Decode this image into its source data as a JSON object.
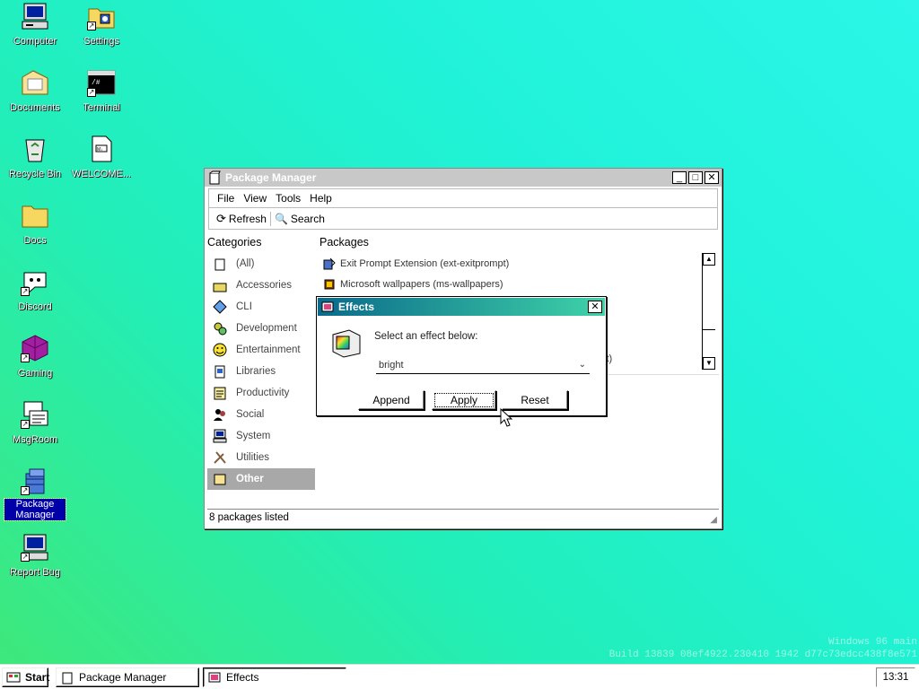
{
  "desktop": {
    "icons": [
      {
        "label": "Computer",
        "icon": "computer-icon"
      },
      {
        "label": "Settings",
        "icon": "settings-folder-icon"
      },
      {
        "label": "Documents",
        "icon": "documents-folder-icon"
      },
      {
        "label": "Terminal",
        "icon": "terminal-icon"
      },
      {
        "label": "Recycle Bin",
        "icon": "recycle-bin-icon"
      },
      {
        "label": "WELCOME...",
        "icon": "document-icon"
      },
      {
        "label": "Docs",
        "icon": "folder-icon"
      },
      {
        "label": "Discord",
        "icon": "discord-icon"
      },
      {
        "label": "Gaming",
        "icon": "gaming-icon"
      },
      {
        "label": "MsgRoom",
        "icon": "msgroom-icon"
      },
      {
        "label": "Package Manager",
        "icon": "package-manager-icon"
      },
      {
        "label": "Report Bug",
        "icon": "report-bug-icon"
      }
    ],
    "watermark": {
      "line1": "Windows 96 main",
      "line2": "Build 13839 08ef4922.230410 1942 d77c73edcc438f8e571"
    }
  },
  "package_manager": {
    "title": "Package Manager",
    "menu": [
      "File",
      "View",
      "Tools",
      "Help"
    ],
    "toolbar": {
      "refresh": "Refresh",
      "search": "Search"
    },
    "categories_header": "Categories",
    "packages_header": "Packages",
    "categories": [
      {
        "label": "(All)",
        "icon": "all-icon"
      },
      {
        "label": "Accessories",
        "icon": "accessories-icon"
      },
      {
        "label": "CLI",
        "icon": "cli-icon"
      },
      {
        "label": "Development",
        "icon": "development-icon"
      },
      {
        "label": "Entertainment",
        "icon": "entertainment-icon"
      },
      {
        "label": "Libraries",
        "icon": "libraries-icon"
      },
      {
        "label": "Productivity",
        "icon": "productivity-icon"
      },
      {
        "label": "Social",
        "icon": "social-icon"
      },
      {
        "label": "System",
        "icon": "system-icon"
      },
      {
        "label": "Utilities",
        "icon": "utilities-icon"
      },
      {
        "label": "Other",
        "icon": "other-icon",
        "selected": true
      }
    ],
    "packages": [
      "Exit Prompt Extension (ext-exitprompt)",
      "Microsoft wallpapers (ms-wallpapers)"
    ],
    "partial_package_suffix": "ct)",
    "status": "8 packages listed"
  },
  "effects_dialog": {
    "title": "Effects",
    "prompt": "Select an effect below:",
    "selected_effect": "bright",
    "buttons": {
      "append": "Append",
      "apply": "Apply",
      "reset": "Reset"
    }
  },
  "taskbar": {
    "start": "Start",
    "tasks": [
      "Package Manager",
      "Effects"
    ],
    "clock": "13:31"
  },
  "colors": {
    "title_active_start": "#0b6a8a",
    "title_active_end": "#3fd3a8",
    "title_inactive": "#c8c8c8",
    "selection": "#0000a8"
  }
}
